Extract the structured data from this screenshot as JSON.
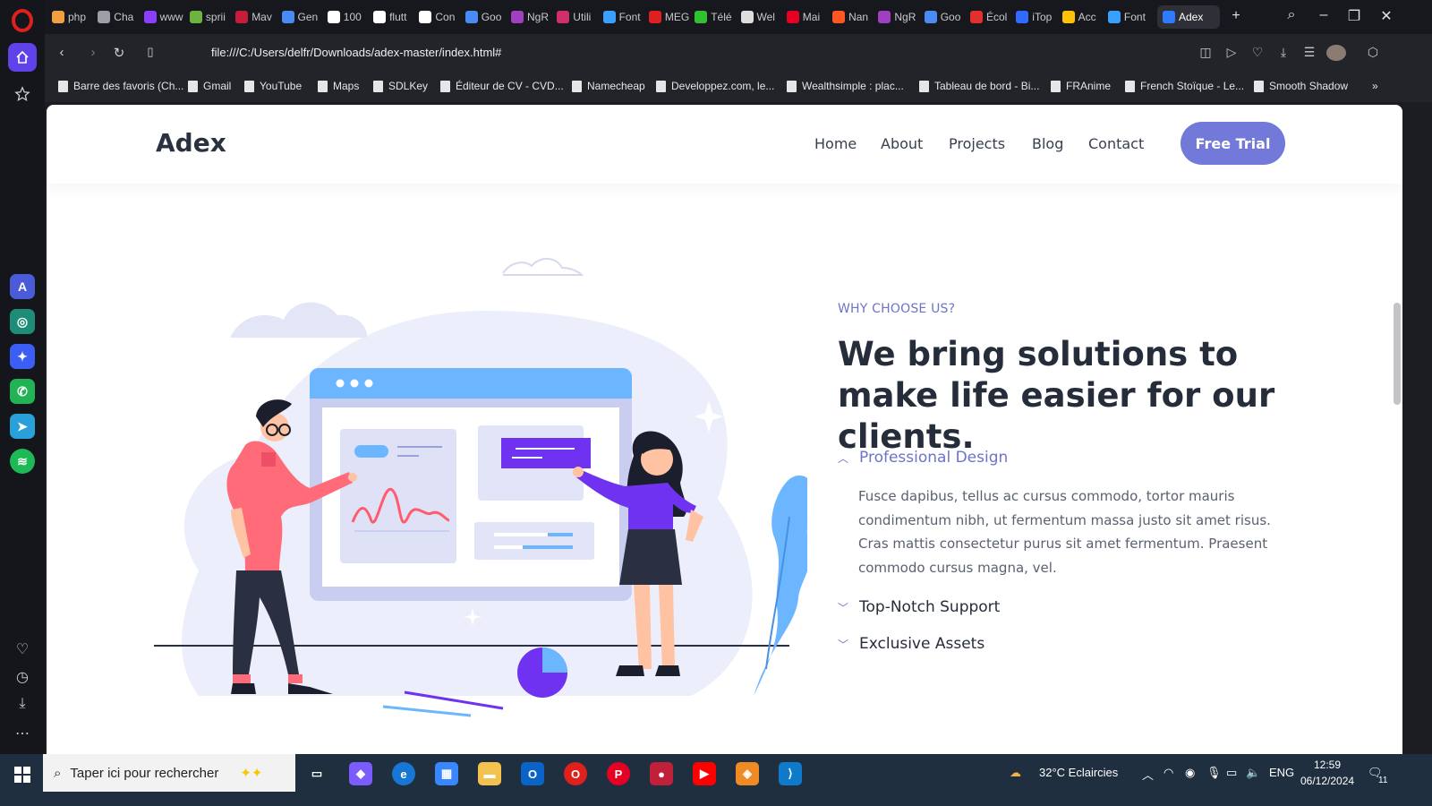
{
  "browser": {
    "tabs": [
      {
        "label": "php",
        "color": "#f0a040"
      },
      {
        "label": "Cha",
        "color": "#9aa0a6"
      },
      {
        "label": "www",
        "color": "#8a3ffc"
      },
      {
        "label": "sprii",
        "color": "#6db33f"
      },
      {
        "label": "Mav",
        "color": "#c41e3a"
      },
      {
        "label": "Gen",
        "color": "#4a8af4"
      },
      {
        "label": "100",
        "color": "#ffffff"
      },
      {
        "label": "flutt",
        "color": "#ffffff"
      },
      {
        "label": "Con",
        "color": "#ffffff"
      },
      {
        "label": "Goo",
        "color": "#4a8af4"
      },
      {
        "label": "NgR",
        "color": "#a040c0"
      },
      {
        "label": "Utili",
        "color": "#d0306a"
      },
      {
        "label": "Font",
        "color": "#3aa0ff"
      },
      {
        "label": "MEG",
        "color": "#e02020"
      },
      {
        "label": "Télé",
        "color": "#30c030"
      },
      {
        "label": "Wel",
        "color": "#dddddd"
      },
      {
        "label": "Mai",
        "color": "#e60023"
      },
      {
        "label": "Nan",
        "color": "#ff5722"
      },
      {
        "label": "NgR",
        "color": "#a040c0"
      },
      {
        "label": "Goo",
        "color": "#4a8af4"
      },
      {
        "label": "Écol",
        "color": "#e03030"
      },
      {
        "label": "iTop",
        "color": "#2f6bff"
      },
      {
        "label": "Acc",
        "color": "#ffc107"
      },
      {
        "label": "Font",
        "color": "#3aa0ff"
      },
      {
        "label": "Adex",
        "color": "#2f7bff"
      }
    ],
    "url": "file:///C:/Users/delfr/Downloads/adex-master/index.html#",
    "bookmarks": [
      "Barre des favoris (Ch...",
      "Gmail",
      "YouTube",
      "Maps",
      "SDLKey",
      "Éditeur de CV - CVD...",
      "Namecheap",
      "Developpez.com, le...",
      "Wealthsimple : plac...",
      "Tableau de bord - Bi...",
      "FRAnime",
      "French Stoïque - Le...",
      "Smooth Shadow"
    ]
  },
  "site": {
    "brand": "Adex",
    "nav": [
      "Home",
      "About",
      "Projects",
      "Blog",
      "Contact"
    ],
    "cta": "Free Trial",
    "eyebrow": "WHY CHOOSE US?",
    "headline": "We bring solutions to make life easier for our clients.",
    "accordion": [
      {
        "title": "Professional Design",
        "open": true,
        "body": "Fusce dapibus, tellus ac cursus commodo, tortor mauris condimentum nibh, ut fermentum massa justo sit amet risus. Cras mattis consectetur purus sit amet fermentum. Praesent commodo cursus magna, vel."
      },
      {
        "title": "Top-Notch Support",
        "open": false
      },
      {
        "title": "Exclusive Assets",
        "open": false
      }
    ],
    "colors": {
      "accent": "#7379d8",
      "heading": "#262d3a",
      "illustration_blue": "#6cb6ff",
      "illustration_purple": "#6f32f0",
      "illustration_pink": "#ff6b78"
    }
  },
  "taskbar": {
    "search_placeholder": "Taper ici pour rechercher",
    "weather": "32°C  Eclaircies",
    "lang": "ENG",
    "time": "12:59",
    "date": "06/12/2024",
    "notifications": "11"
  }
}
